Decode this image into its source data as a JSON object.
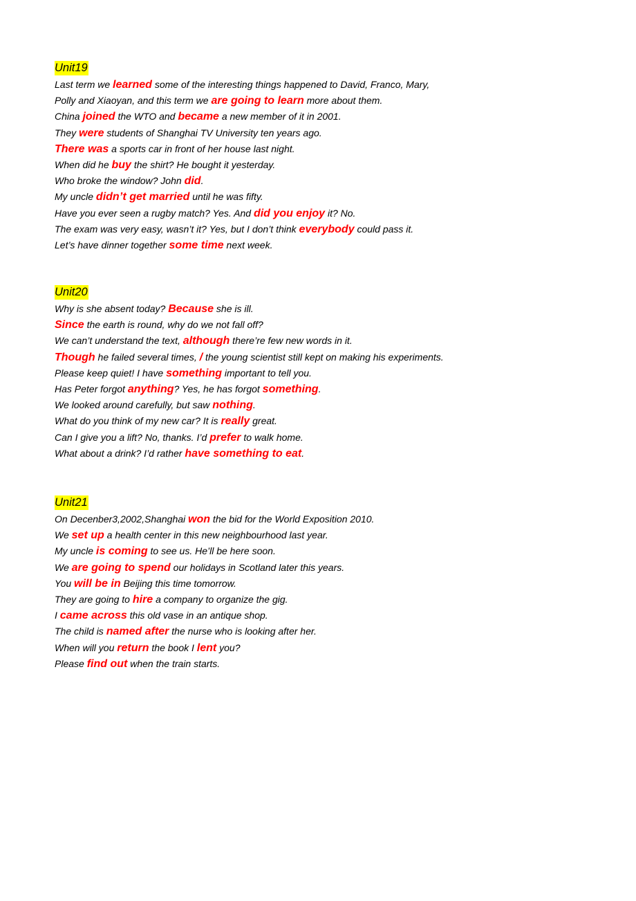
{
  "colors": {
    "highlight_bg": "#ffff00",
    "answer": "#ff0000",
    "text": "#000000"
  },
  "sections": [
    {
      "title": "Unit19",
      "lines": [
        [
          {
            "t": "Last term we "
          },
          {
            "t": "learned",
            "h": true
          },
          {
            "t": " some of the interesting things happened to David, Franco, Mary,"
          }
        ],
        [
          {
            "t": "Polly and Xiaoyan, and this term we "
          },
          {
            "t": "are going to learn",
            "h": true
          },
          {
            "t": " more about them."
          }
        ],
        [
          {
            "t": "China "
          },
          {
            "t": "joined",
            "h": true
          },
          {
            "t": " the WTO and "
          },
          {
            "t": "became",
            "h": true
          },
          {
            "t": " a new member of it in 2001."
          }
        ],
        [
          {
            "t": "They "
          },
          {
            "t": "were",
            "h": true
          },
          {
            "t": " students of Shanghai TV University ten years ago."
          }
        ],
        [
          {
            "t": "There was",
            "h": true
          },
          {
            "t": " a sports car in front of her house last night."
          }
        ],
        [
          {
            "t": "When did he "
          },
          {
            "t": "buy",
            "h": true
          },
          {
            "t": " the shirt? He bought it yesterday."
          }
        ],
        [
          {
            "t": "Who broke the window? John "
          },
          {
            "t": "did",
            "h": true
          },
          {
            "t": "."
          }
        ],
        [
          {
            "t": "My uncle "
          },
          {
            "t": "didn’t get married",
            "h": true
          },
          {
            "t": " until he was fifty."
          }
        ],
        [
          {
            "t": "Have you ever seen a rugby match? Yes. And "
          },
          {
            "t": "did you enjoy",
            "h": true
          },
          {
            "t": " it? No."
          }
        ],
        [
          {
            "t": "The exam was very easy, wasn’t it? Yes, but I don’t think "
          },
          {
            "t": "everybody",
            "h": true
          },
          {
            "t": " could pass it."
          }
        ],
        [
          {
            "t": "Let’s have dinner together "
          },
          {
            "t": "some time",
            "h": true
          },
          {
            "t": " next week."
          }
        ]
      ]
    },
    {
      "title": "Unit20",
      "lines": [
        [
          {
            "t": "Why is she absent today? "
          },
          {
            "t": "Because",
            "h": true
          },
          {
            "t": " she is ill."
          }
        ],
        [
          {
            "t": "Since",
            "h": true
          },
          {
            "t": " the earth is round, why do we not fall off?"
          }
        ],
        [
          {
            "t": "We can’t understand the text, "
          },
          {
            "t": "although",
            "h": true
          },
          {
            "t": " there’re few new words in it."
          }
        ],
        [
          {
            "t": "Though",
            "h": true
          },
          {
            "t": " he failed several times, "
          },
          {
            "t": "/",
            "h": true
          },
          {
            "t": " the young scientist still kept on making his experiments."
          }
        ],
        [
          {
            "t": "Please keep quiet! I have "
          },
          {
            "t": "something",
            "h": true
          },
          {
            "t": " important to tell you."
          }
        ],
        [
          {
            "t": "Has Peter forgot "
          },
          {
            "t": "anything",
            "h": true
          },
          {
            "t": "? Yes, he has forgot "
          },
          {
            "t": "something",
            "h": true
          },
          {
            "t": "."
          }
        ],
        [
          {
            "t": "We looked around carefully, but saw "
          },
          {
            "t": "nothing",
            "h": true
          },
          {
            "t": "."
          }
        ],
        [
          {
            "t": "What do you think of my new car? It is "
          },
          {
            "t": "really",
            "h": true
          },
          {
            "t": " great."
          }
        ],
        [
          {
            "t": "Can I give you a lift? No, thanks. I’d "
          },
          {
            "t": "prefer",
            "h": true
          },
          {
            "t": " to walk home."
          }
        ],
        [
          {
            "t": "What about a drink? I’d rather "
          },
          {
            "t": "have something to eat",
            "h": true
          },
          {
            "t": "."
          }
        ]
      ]
    },
    {
      "title": "Unit21",
      "lines": [
        [
          {
            "t": "On Decenber3,2002,Shanghai "
          },
          {
            "t": "won",
            "h": true
          },
          {
            "t": " the bid for the World Exposition 2010."
          }
        ],
        [
          {
            "t": "We "
          },
          {
            "t": "set up",
            "h": true
          },
          {
            "t": " a health center in this new neighbourhood last year."
          }
        ],
        [
          {
            "t": "My uncle "
          },
          {
            "t": "is coming",
            "h": true
          },
          {
            "t": " to see us. He’ll be here soon."
          }
        ],
        [
          {
            "t": "We "
          },
          {
            "t": "are going to spend",
            "h": true
          },
          {
            "t": " our holidays in Scotland later this years."
          }
        ],
        [
          {
            "t": "You "
          },
          {
            "t": "will be in",
            "h": true
          },
          {
            "t": " Beijing this time tomorrow."
          }
        ],
        [
          {
            "t": "They are going to "
          },
          {
            "t": "hire",
            "h": true
          },
          {
            "t": " a company to organize the gig."
          }
        ],
        [
          {
            "t": "I "
          },
          {
            "t": "came across",
            "h": true
          },
          {
            "t": " this old vase in an antique shop."
          }
        ],
        [
          {
            "t": "The child is "
          },
          {
            "t": "named after",
            "h": true
          },
          {
            "t": " the nurse who is looking after her."
          }
        ],
        [
          {
            "t": "When will you "
          },
          {
            "t": "return",
            "h": true
          },
          {
            "t": " the book I "
          },
          {
            "t": "lent",
            "h": true
          },
          {
            "t": " you?"
          }
        ],
        [
          {
            "t": "Please "
          },
          {
            "t": "find out",
            "h": true
          },
          {
            "t": " when the train starts."
          }
        ]
      ]
    }
  ]
}
